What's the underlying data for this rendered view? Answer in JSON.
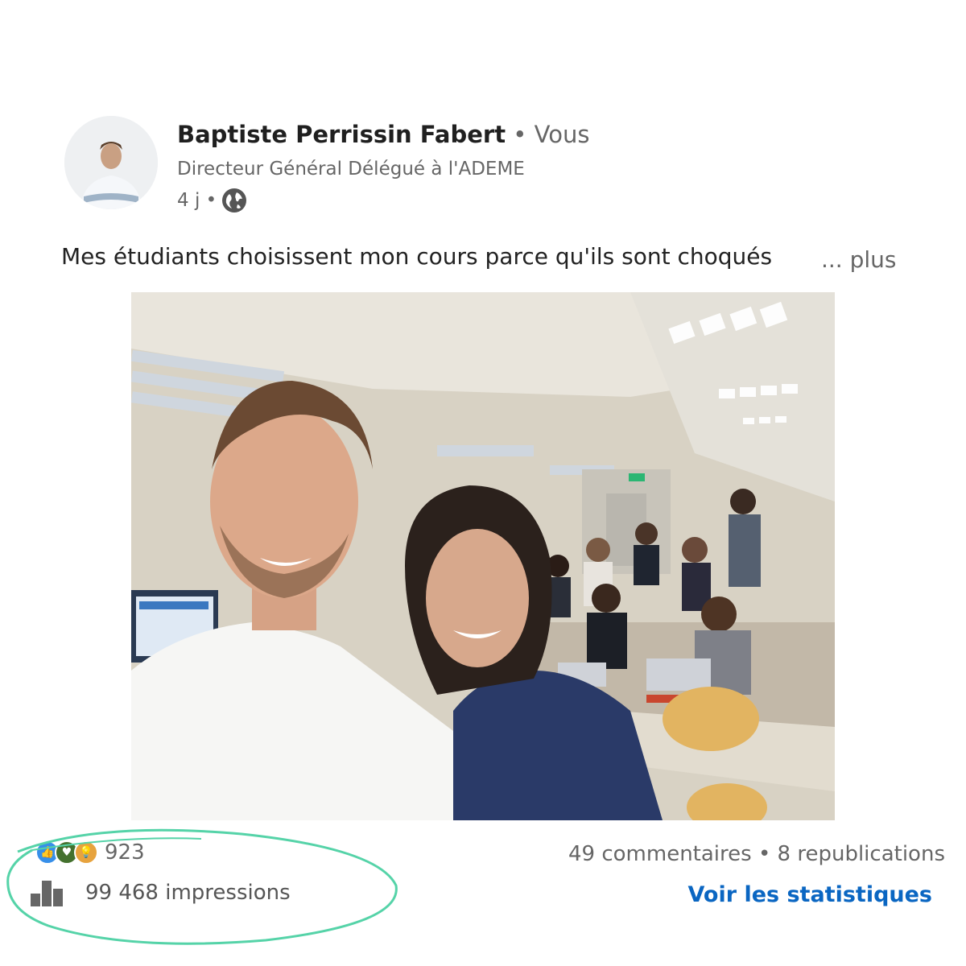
{
  "author": {
    "name": "Baptiste Perrissin Fabert",
    "relation": " • Vous",
    "title": "Directeur Général Délégué à l'ADEME",
    "age": "4 j •",
    "visibility_icon": "globe-icon"
  },
  "post": {
    "text": "Mes étudiants choisissent mon cours parce qu'ils sont choqués",
    "more": "... plus",
    "photo_alt": "classroom-selfie"
  },
  "stats": {
    "reaction_icons": [
      "like-icon",
      "support-icon",
      "insightful-icon"
    ],
    "reaction_count": "923",
    "impressions": "99 468 impressions",
    "comments_reposts": "49 commentaires • 8 republications",
    "view_stats": "Voir les statistiques"
  },
  "colors": {
    "link": "#0a66c2",
    "highlight": "#55d3a8"
  }
}
